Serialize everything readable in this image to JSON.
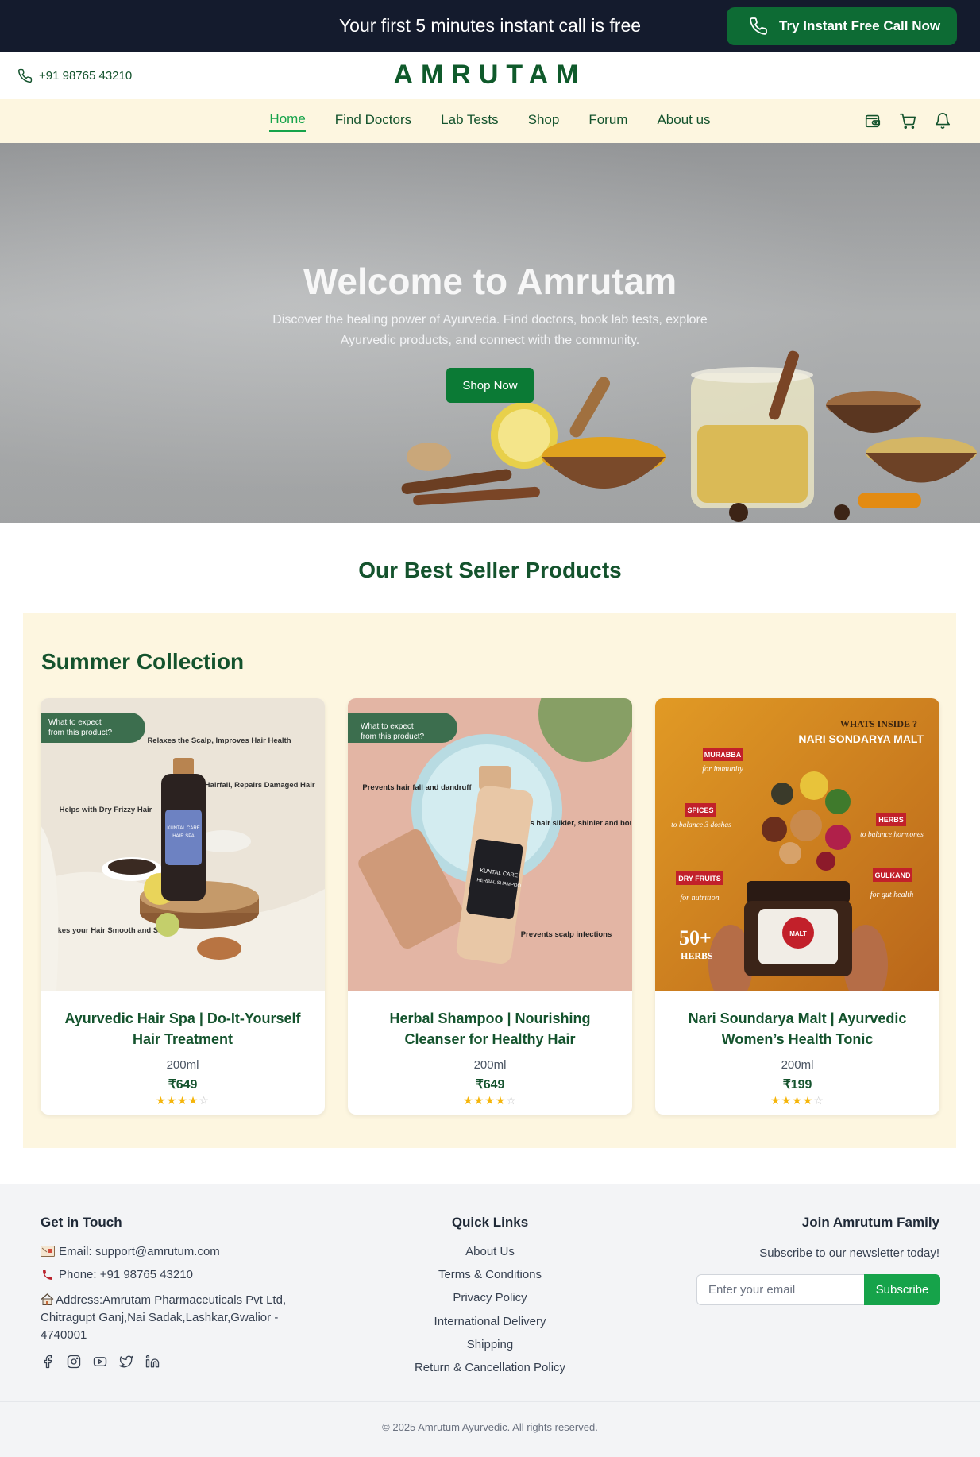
{
  "banner": {
    "text": "Your first 5 minutes instant call is free",
    "cta_label": "Try Instant Free Call Now"
  },
  "header": {
    "phone": "+91 98765 43210",
    "logo": "AMRUTAM"
  },
  "nav": {
    "links": [
      "Home",
      "Find Doctors",
      "Lab Tests",
      "Shop",
      "Forum",
      "About us"
    ],
    "active": "Home",
    "icons": [
      "wallet-icon",
      "cart-icon",
      "bell-icon"
    ]
  },
  "hero": {
    "title": "Welcome to Amrutam",
    "subtitle": "Discover the healing power of Ayurveda. Find doctors, book lab tests, explore Ayurvedic products, and connect with the community.",
    "button": "Shop Now"
  },
  "bestsellers": {
    "title": "Our Best Seller Products",
    "collection_title": "Summer Collection",
    "products": [
      {
        "name": "Ayurvedic Hair Spa | Do-It-Yourself Hair Treatment",
        "size": "200ml",
        "price": "₹649",
        "rating": 4,
        "image": {
          "tag": "What to expect from this product?",
          "c1": "Relaxes the Scalp, Improves Hair Health",
          "c2": "Reduces Hairfall, Repairs Damaged Hair",
          "c3": "Helps with Dry Frizzy Hair",
          "c4": "Makes your Hair Smooth and Shiny",
          "label_top": "KUNTAL CARE",
          "label_bottom": "HAIR SPA"
        }
      },
      {
        "name": "Herbal Shampoo | Nourishing Cleanser for Healthy Hair",
        "size": "200ml",
        "price": "₹649",
        "rating": 4,
        "image": {
          "tag": "What to expect from this product?",
          "c1": "Prevents hair fall and dandruff",
          "c2": "Makes hair silkier, shinier and bouncier!",
          "c3": "Prevents scalp infections",
          "label_top": "KUNTAL CARE",
          "label_bottom": "HERBAL SHAMPOO"
        }
      },
      {
        "name": "Nari Soundarya Malt | Ayurvedic Women’s Health Tonic",
        "size": "200ml",
        "price": "₹199",
        "rating": 4,
        "image": {
          "heading1": "WHATS INSIDE ?",
          "heading2": "NARI SONDARYA MALT",
          "i1_tag": "MURABBA",
          "i1_sub": "for immunity",
          "i2_tag": "SPICES",
          "i2_sub": "to balance 3 doshas",
          "i3_tag": "HERBS",
          "i3_sub": "to balance hormones",
          "i4_tag": "DRY FRUITS",
          "i4_sub": "for nutrition",
          "i5_tag": "GULKAND",
          "i5_sub": "for gut health",
          "count": "50+",
          "count_label": "HERBS",
          "jar_label": "MALT"
        }
      }
    ]
  },
  "footer": {
    "contact": {
      "title": "Get in Touch",
      "email": "Email: support@amrutum.com",
      "phone": "Phone: +91 98765 43210",
      "address": "Address:Amrutam Pharmaceuticals Pvt Ltd, Chitragupt Ganj,Nai Sadak,Lashkar,Gwalior - 4740001",
      "socials": [
        "facebook-icon",
        "instagram-icon",
        "youtube-icon",
        "twitter-icon",
        "linkedin-icon"
      ]
    },
    "quick_links": {
      "title": "Quick Links",
      "links": [
        "About Us",
        "Terms & Conditions",
        "Privacy Policy",
        "International Delivery",
        "Shipping",
        "Return & Cancellation Policy"
      ]
    },
    "newsletter": {
      "title": "Join Amrutum Family",
      "subtitle": "Subscribe to our newsletter today!",
      "placeholder": "Enter your email",
      "button": "Subscribe"
    },
    "copyright": "© 2025 Amrutum Ayurvedic. All rights reserved."
  },
  "colors": {
    "banner_bg": "#141b2d",
    "brand_green": "#0f5a2b",
    "accent_green": "#16a34a",
    "cream": "#fdf6e0",
    "star": "#f5b50a"
  }
}
